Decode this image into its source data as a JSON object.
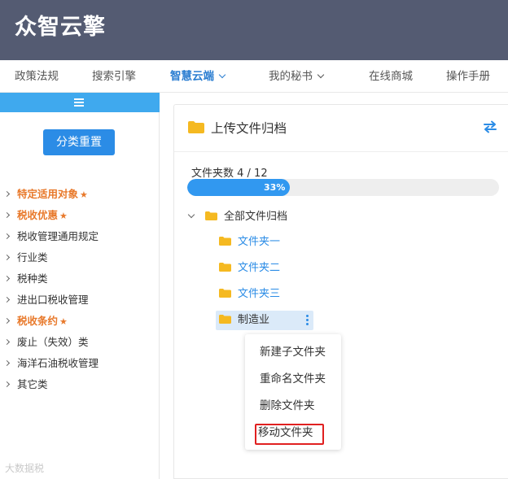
{
  "header": {
    "logo": "众智云擎"
  },
  "nav": {
    "items": [
      {
        "label": "政策法规"
      },
      {
        "label": "搜索引擎"
      },
      {
        "label": "智慧云端"
      },
      {
        "label": "我的秘书"
      },
      {
        "label": "在线商城"
      },
      {
        "label": "操作手册"
      }
    ]
  },
  "sidebar": {
    "reset_label": "分类重置",
    "categories": [
      {
        "label": "特定适用对象",
        "starred": true
      },
      {
        "label": "税收优惠",
        "starred": true
      },
      {
        "label": "税收管理通用规定"
      },
      {
        "label": "行业类"
      },
      {
        "label": "税种类"
      },
      {
        "label": "进出口税收管理"
      },
      {
        "label": "税收条约",
        "starred": true
      },
      {
        "label": "废止（失效）类"
      },
      {
        "label": "海洋石油税收管理"
      },
      {
        "label": "其它类"
      }
    ],
    "star": "★",
    "watermark": "大数据税"
  },
  "panel": {
    "title": "上传文件归档",
    "count_label": "文件夹数 4 / 12",
    "progress": {
      "text": "33%",
      "fraction": 0.33
    },
    "tree": {
      "root": "全部文件归档",
      "nodes": [
        {
          "label": "文件夹一"
        },
        {
          "label": "文件夹二"
        },
        {
          "label": "文件夹三"
        },
        {
          "label": "制造业"
        }
      ]
    },
    "context_menu": {
      "items": [
        {
          "label": "新建子文件夹"
        },
        {
          "label": "重命名文件夹"
        },
        {
          "label": "删除文件夹"
        },
        {
          "label": "移动文件夹"
        }
      ]
    }
  },
  "colors": {
    "header_bg": "#545b72",
    "accent": "#2b8ce6",
    "highlight_orange": "#e8792b",
    "progress_fill": "#3198f0",
    "selection_border": "#e02020"
  }
}
